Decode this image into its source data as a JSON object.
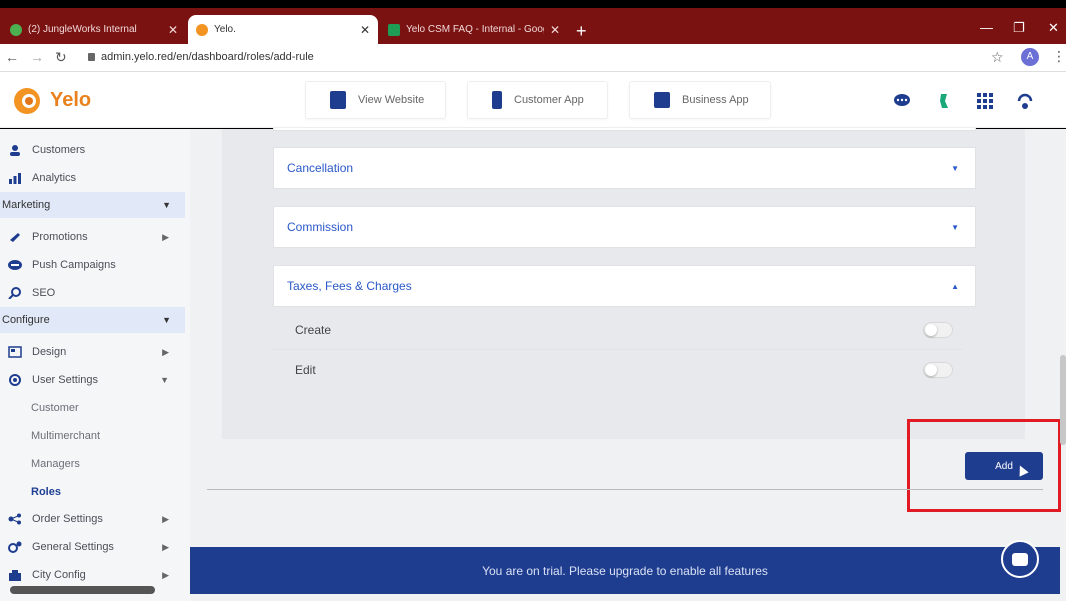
{
  "browser": {
    "tabs": [
      {
        "title": "(2) JungleWorks Internal",
        "close": "✕"
      },
      {
        "title": "Yelo.",
        "close": "✕"
      },
      {
        "title": "Yelo CSM FAQ - Internal - Google",
        "close": "✕"
      }
    ],
    "new_tab": "+",
    "url": "admin.yelo.red/en/dashboard/roles/add-rule",
    "profile_initial": "A"
  },
  "header": {
    "logo_text": "Yelo",
    "buttons": [
      {
        "label": "View Website",
        "icon": "website-icon"
      },
      {
        "label": "Customer App",
        "icon": "phone-icon"
      },
      {
        "label": "Business App",
        "icon": "store-icon"
      }
    ]
  },
  "sidebar": {
    "items": [
      {
        "label": "Customers",
        "icon": "customers-icon"
      },
      {
        "label": "Analytics",
        "icon": "analytics-icon"
      },
      {
        "label": "Marketing",
        "section": true
      },
      {
        "label": "Promotions",
        "icon": "promotions-icon",
        "expandable": true
      },
      {
        "label": "Push Campaigns",
        "icon": "push-campaigns-icon"
      },
      {
        "label": "SEO",
        "icon": "seo-icon"
      },
      {
        "label": "Configure",
        "section": true
      },
      {
        "label": "Design",
        "icon": "design-icon",
        "expandable": true
      },
      {
        "label": "User Settings",
        "icon": "user-settings-icon",
        "expanded": true
      },
      {
        "label": "Customer",
        "sub": true
      },
      {
        "label": "Multimerchant",
        "sub": true
      },
      {
        "label": "Managers",
        "sub": true
      },
      {
        "label": "Roles",
        "sub": true,
        "active": true
      },
      {
        "label": "Order Settings",
        "icon": "order-settings-icon",
        "expandable": true
      },
      {
        "label": "General Settings",
        "icon": "general-settings-icon",
        "expandable": true
      },
      {
        "label": "City Config",
        "icon": "city-config-icon",
        "expandable": true
      }
    ]
  },
  "main": {
    "accordions": [
      {
        "label": "Cancellation",
        "open": false
      },
      {
        "label": "Commission",
        "open": false
      },
      {
        "label": "Taxes, Fees & Charges",
        "open": true
      }
    ],
    "permissions": [
      {
        "label": "Create",
        "enabled": false
      },
      {
        "label": "Edit",
        "enabled": false
      }
    ],
    "add_label": "Add",
    "trial_banner": "You are on trial. Please upgrade to enable all features"
  },
  "colors": {
    "brand_blue": "#1f3d8f",
    "brand_orange": "#e9821e",
    "link_blue": "#2a58c9",
    "highlight_red": "#e01b24",
    "tabbar": "#7a1212"
  }
}
